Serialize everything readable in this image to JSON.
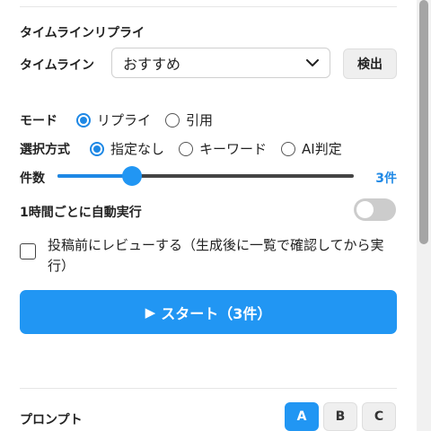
{
  "section": {
    "title": "タイムラインリプライ"
  },
  "timeline": {
    "label": "タイムライン",
    "selected": "おすすめ",
    "detect_label": "検出"
  },
  "mode": {
    "label": "モード",
    "options": [
      {
        "label": "リプライ",
        "selected": true
      },
      {
        "label": "引用",
        "selected": false
      }
    ]
  },
  "selection": {
    "label": "選択方式",
    "options": [
      {
        "label": "指定なし",
        "selected": true
      },
      {
        "label": "キーワード",
        "selected": false
      },
      {
        "label": "AI判定",
        "selected": false
      }
    ]
  },
  "count": {
    "label": "件数",
    "value_text": "3件",
    "fraction": 0.25
  },
  "auto_run": {
    "label": "1時間ごとに自動実行",
    "enabled": false
  },
  "review": {
    "label": "投稿前にレビューする（生成後に一覧で確認してから実行）",
    "checked": false
  },
  "start": {
    "label": "スタート（3件）"
  },
  "prompt": {
    "label": "プロンプト",
    "tabs": [
      {
        "label": "A",
        "active": true
      },
      {
        "label": "B",
        "active": false
      },
      {
        "label": "C",
        "active": false
      }
    ]
  },
  "colors": {
    "accent": "#2196f3",
    "track": "#444444",
    "toggle_off": "#cccccc"
  }
}
